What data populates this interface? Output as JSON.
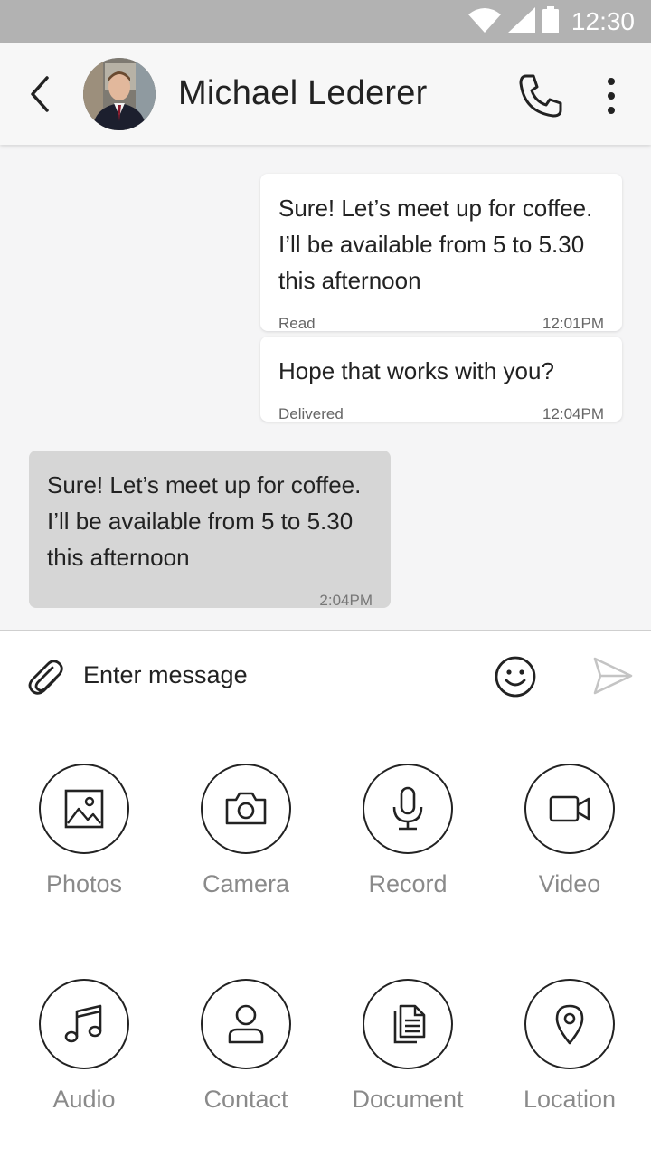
{
  "status_bar": {
    "time": "12:30",
    "icons": [
      "wifi-icon",
      "signal-icon",
      "battery-icon"
    ]
  },
  "header": {
    "contact_name": "Michael Lederer",
    "icons": [
      "back-icon",
      "phone-icon",
      "more-vert-icon"
    ]
  },
  "messages": [
    {
      "direction": "outgoing",
      "text": "Sure! Let’s meet up for coffee. I’ll be available from 5 to 5.30 this afternoon",
      "status": "Read",
      "time": "12:01PM"
    },
    {
      "direction": "outgoing",
      "text": "Hope that works with you?",
      "status": "Delivered",
      "time": "12:04PM"
    },
    {
      "direction": "incoming",
      "text": "Sure! Let’s meet up for coffee. I’ll be available from 5 to 5.30 this afternoon",
      "status": "",
      "time": "2:04PM"
    }
  ],
  "composer": {
    "placeholder": "Enter message",
    "value": ""
  },
  "attachments": [
    {
      "label": "Photos",
      "icon": "photo-icon"
    },
    {
      "label": "Camera",
      "icon": "camera-icon"
    },
    {
      "label": "Record",
      "icon": "microphone-icon"
    },
    {
      "label": "Video",
      "icon": "video-icon"
    },
    {
      "label": "Audio",
      "icon": "music-note-icon"
    },
    {
      "label": "Contact",
      "icon": "person-icon"
    },
    {
      "label": "Document",
      "icon": "document-icon"
    },
    {
      "label": "Location",
      "icon": "location-pin-icon"
    }
  ],
  "colors": {
    "status_bar": "#b2b2b2",
    "app_bar": "#f7f7f7",
    "chat_background": "#f5f5f6",
    "outgoing_bubble": "#ffffff",
    "incoming_bubble": "#d6d6d6",
    "tray_label": "#8a8a8a"
  }
}
